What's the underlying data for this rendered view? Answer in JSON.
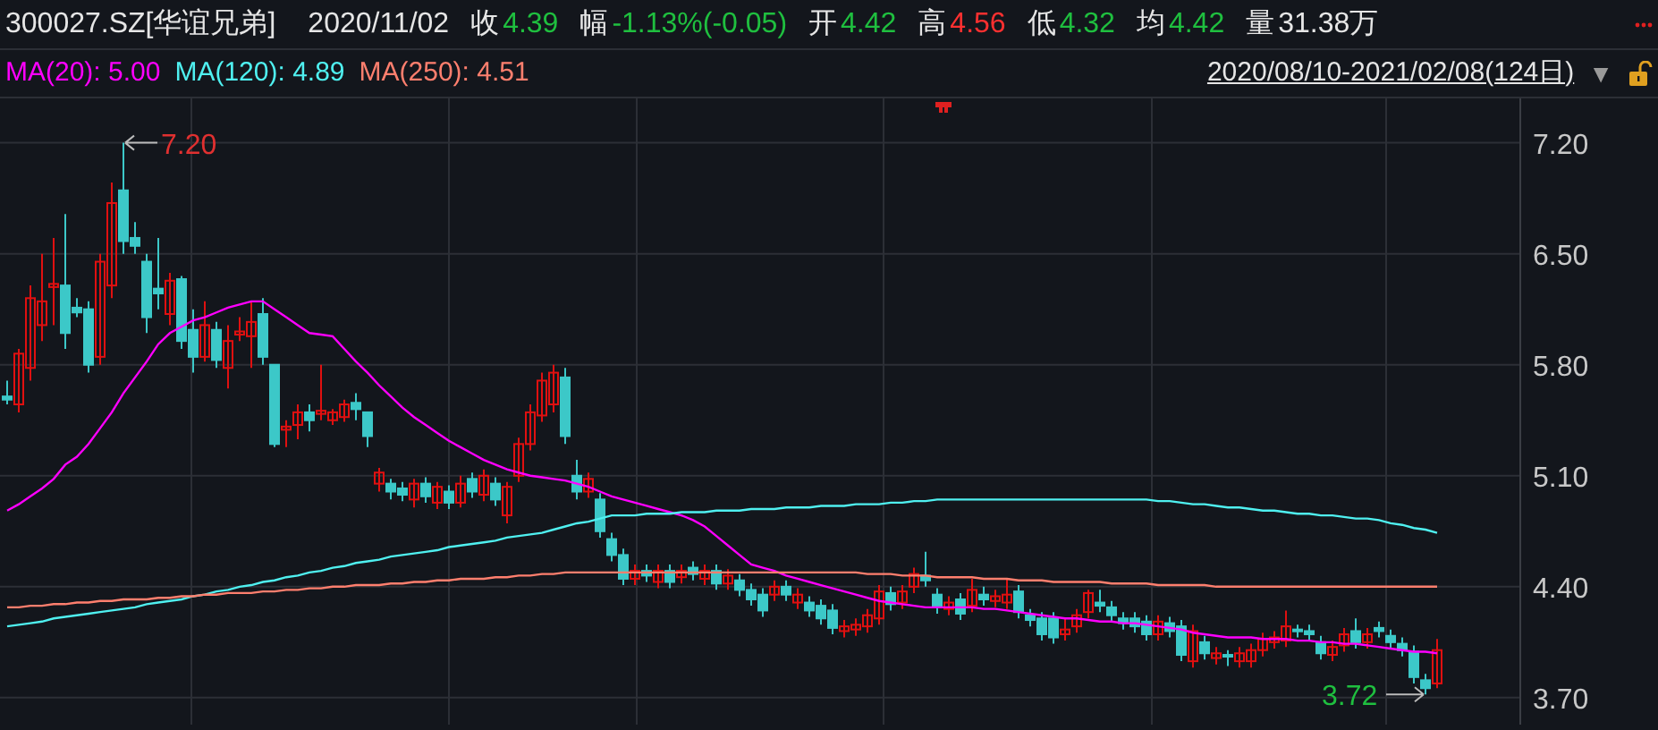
{
  "header": {
    "symbol": "300027.SZ[华谊兄弟]",
    "date": "2020/11/02",
    "quotes": [
      {
        "label": "收",
        "value": "4.39",
        "color": "#1fbf3f"
      },
      {
        "label": "幅",
        "value": "-1.13%(-0.05)",
        "color": "#1fbf3f"
      },
      {
        "label": "开",
        "value": "4.42",
        "color": "#1fbf3f"
      },
      {
        "label": "高",
        "value": "4.56",
        "color": "#ff3030"
      },
      {
        "label": "低",
        "value": "4.32",
        "color": "#1fbf3f"
      },
      {
        "label": "均",
        "value": "4.42",
        "color": "#1fbf3f"
      },
      {
        "label": "量",
        "value": "31.38万",
        "color": "#e6e6e6"
      }
    ]
  },
  "range": {
    "label": "2020/08/10-2021/02/08(124日)",
    "dropdown": "▼",
    "locked": false
  },
  "chart_data": {
    "type": "candlestick",
    "grid": true,
    "ohlc": [
      [
        5.6,
        5.7,
        5.55,
        5.58
      ],
      [
        5.55,
        5.9,
        5.5,
        5.87
      ],
      [
        5.78,
        6.3,
        5.7,
        6.22
      ],
      [
        6.05,
        6.5,
        5.95,
        6.2
      ],
      [
        6.29,
        6.6,
        6.05,
        6.31
      ],
      [
        6.3,
        6.75,
        5.9,
        6.0
      ],
      [
        6.16,
        6.22,
        6.1,
        6.13
      ],
      [
        6.15,
        6.2,
        5.75,
        5.8
      ],
      [
        5.85,
        6.5,
        5.8,
        6.45
      ],
      [
        6.3,
        6.95,
        6.22,
        6.82
      ],
      [
        6.9,
        7.2,
        6.5,
        6.58
      ],
      [
        6.6,
        6.7,
        6.5,
        6.55
      ],
      [
        6.45,
        6.5,
        6.0,
        6.1
      ],
      [
        6.28,
        6.6,
        6.15,
        6.25
      ],
      [
        6.12,
        6.38,
        6.05,
        6.33
      ],
      [
        6.34,
        6.36,
        5.9,
        5.95
      ],
      [
        6.02,
        6.15,
        5.75,
        5.85
      ],
      [
        5.85,
        6.2,
        5.82,
        6.05
      ],
      [
        6.02,
        6.07,
        5.78,
        5.83
      ],
      [
        5.78,
        6.05,
        5.65,
        5.95
      ],
      [
        5.99,
        6.1,
        5.95,
        6.01
      ],
      [
        5.98,
        6.2,
        5.78,
        6.07
      ],
      [
        6.12,
        6.22,
        5.8,
        5.85
      ],
      [
        5.8,
        5.8,
        5.28,
        5.3
      ],
      [
        5.39,
        5.45,
        5.28,
        5.41
      ],
      [
        5.42,
        5.55,
        5.33,
        5.5
      ],
      [
        5.5,
        5.55,
        5.38,
        5.45
      ],
      [
        5.49,
        5.8,
        5.45,
        5.51
      ],
      [
        5.45,
        5.52,
        5.42,
        5.5
      ],
      [
        5.47,
        5.58,
        5.44,
        5.55
      ],
      [
        5.56,
        5.62,
        5.45,
        5.52
      ],
      [
        5.5,
        5.5,
        5.28,
        5.35
      ],
      [
        5.05,
        5.15,
        5.0,
        5.12
      ],
      [
        5.05,
        5.08,
        4.95,
        5.0
      ],
      [
        5.02,
        5.06,
        4.94,
        4.98
      ],
      [
        4.95,
        5.08,
        4.9,
        5.05
      ],
      [
        5.05,
        5.09,
        4.93,
        4.97
      ],
      [
        4.93,
        5.06,
        4.89,
        5.03
      ],
      [
        5.0,
        5.04,
        4.89,
        4.93
      ],
      [
        4.93,
        5.1,
        4.9,
        5.05
      ],
      [
        5.08,
        5.12,
        4.96,
        5.0
      ],
      [
        4.98,
        5.14,
        4.94,
        5.1
      ],
      [
        5.05,
        5.09,
        4.91,
        4.95
      ],
      [
        4.85,
        5.06,
        4.8,
        5.03
      ],
      [
        5.1,
        5.34,
        5.06,
        5.3
      ],
      [
        5.3,
        5.55,
        5.26,
        5.5
      ],
      [
        5.48,
        5.75,
        5.44,
        5.7
      ],
      [
        5.55,
        5.8,
        5.5,
        5.75
      ],
      [
        5.72,
        5.78,
        5.3,
        5.35
      ],
      [
        5.1,
        5.2,
        4.95,
        5.0
      ],
      [
        5.0,
        5.12,
        4.96,
        5.08
      ],
      [
        4.95,
        4.99,
        4.71,
        4.75
      ],
      [
        4.7,
        4.74,
        4.56,
        4.6
      ],
      [
        4.6,
        4.64,
        4.41,
        4.45
      ],
      [
        4.45,
        4.54,
        4.41,
        4.5
      ],
      [
        4.5,
        4.54,
        4.43,
        4.47
      ],
      [
        4.43,
        4.54,
        4.39,
        4.5
      ],
      [
        4.5,
        4.54,
        4.39,
        4.43
      ],
      [
        4.46,
        4.54,
        4.42,
        4.5
      ],
      [
        4.52,
        4.56,
        4.44,
        4.48
      ],
      [
        4.45,
        4.54,
        4.41,
        4.5
      ],
      [
        4.5,
        4.54,
        4.38,
        4.42
      ],
      [
        4.42,
        4.51,
        4.38,
        4.47
      ],
      [
        4.44,
        4.48,
        4.34,
        4.38
      ],
      [
        4.38,
        4.42,
        4.28,
        4.32
      ],
      [
        4.35,
        4.39,
        4.21,
        4.25
      ],
      [
        4.35,
        4.44,
        4.31,
        4.4
      ],
      [
        4.4,
        4.44,
        4.31,
        4.35
      ],
      [
        4.3,
        4.39,
        4.26,
        4.35
      ],
      [
        4.3,
        4.34,
        4.21,
        4.25
      ],
      [
        4.28,
        4.32,
        4.16,
        4.2
      ],
      [
        4.25,
        4.29,
        4.1,
        4.14
      ],
      [
        4.12,
        4.19,
        4.08,
        4.15
      ],
      [
        4.13,
        4.2,
        4.09,
        4.16
      ],
      [
        4.15,
        4.26,
        4.11,
        4.22
      ],
      [
        4.2,
        4.41,
        4.16,
        4.37
      ],
      [
        4.36,
        4.4,
        4.25,
        4.29
      ],
      [
        4.3,
        4.41,
        4.26,
        4.37
      ],
      [
        4.4,
        4.52,
        4.36,
        4.48
      ],
      [
        4.47,
        4.62,
        4.4,
        4.44
      ],
      [
        4.35,
        4.39,
        4.23,
        4.27
      ],
      [
        4.26,
        4.34,
        4.22,
        4.3
      ],
      [
        4.32,
        4.36,
        4.19,
        4.23
      ],
      [
        4.28,
        4.45,
        4.24,
        4.38
      ],
      [
        4.35,
        4.4,
        4.28,
        4.32
      ],
      [
        4.31,
        4.38,
        4.27,
        4.34
      ],
      [
        4.3,
        4.45,
        4.26,
        4.35
      ],
      [
        4.37,
        4.41,
        4.2,
        4.24
      ],
      [
        4.22,
        4.26,
        4.15,
        4.19
      ],
      [
        4.2,
        4.24,
        4.06,
        4.1
      ],
      [
        4.2,
        4.24,
        4.04,
        4.08
      ],
      [
        4.1,
        4.2,
        4.06,
        4.13
      ],
      [
        4.15,
        4.26,
        4.11,
        4.22
      ],
      [
        4.24,
        4.38,
        4.2,
        4.36
      ],
      [
        4.3,
        4.38,
        4.24,
        4.28
      ],
      [
        4.27,
        4.31,
        4.18,
        4.22
      ],
      [
        4.2,
        4.24,
        4.13,
        4.17
      ],
      [
        4.2,
        4.24,
        4.11,
        4.15
      ],
      [
        4.18,
        4.22,
        4.06,
        4.1
      ],
      [
        4.1,
        4.22,
        4.06,
        4.18
      ],
      [
        4.17,
        4.21,
        4.08,
        4.12
      ],
      [
        4.15,
        4.19,
        3.93,
        3.97
      ],
      [
        3.93,
        4.16,
        3.89,
        4.12
      ],
      [
        4.05,
        4.09,
        3.94,
        3.98
      ],
      [
        3.95,
        4.02,
        3.91,
        3.98
      ],
      [
        3.97,
        4.0,
        3.9,
        3.96
      ],
      [
        3.93,
        4.02,
        3.89,
        3.98
      ],
      [
        3.93,
        4.04,
        3.89,
        4.0
      ],
      [
        4.0,
        4.11,
        3.96,
        4.07
      ],
      [
        4.05,
        4.12,
        4.01,
        4.08
      ],
      [
        4.06,
        4.25,
        4.02,
        4.15
      ],
      [
        4.13,
        4.16,
        4.08,
        4.12
      ],
      [
        4.12,
        4.16,
        4.06,
        4.1
      ],
      [
        4.05,
        4.09,
        3.94,
        3.98
      ],
      [
        3.97,
        4.06,
        3.93,
        4.02
      ],
      [
        4.03,
        4.14,
        3.99,
        4.1
      ],
      [
        4.12,
        4.2,
        4.01,
        4.05
      ],
      [
        4.05,
        4.14,
        4.01,
        4.1
      ],
      [
        4.14,
        4.18,
        4.08,
        4.12
      ],
      [
        4.09,
        4.13,
        4.01,
        4.05
      ],
      [
        4.04,
        4.08,
        3.96,
        4.0
      ],
      [
        3.99,
        4.03,
        3.79,
        3.83
      ],
      [
        3.81,
        3.85,
        3.72,
        3.76
      ],
      [
        3.79,
        4.07,
        3.76,
        4.0
      ]
    ],
    "yticks": [
      {
        "value": 3.7,
        "label": "3.70"
      },
      {
        "value": 4.4,
        "label": "4.40"
      },
      {
        "value": 5.1,
        "label": "5.10"
      },
      {
        "value": 5.8,
        "label": "5.80"
      },
      {
        "value": 6.5,
        "label": "6.50"
      },
      {
        "value": 7.2,
        "label": "7.20"
      }
    ],
    "ylim": [
      3.53,
      7.48
    ],
    "series": [
      {
        "name": "MA(20): 5.00",
        "type": "line",
        "color": "#ff00ff",
        "values": [
          4.88,
          4.92,
          4.97,
          5.02,
          5.08,
          5.17,
          5.22,
          5.3,
          5.4,
          5.5,
          5.62,
          5.72,
          5.82,
          5.93,
          6.0,
          6.04,
          6.08,
          6.1,
          6.13,
          6.16,
          6.18,
          6.2,
          6.2,
          6.15,
          6.1,
          6.05,
          6.0,
          5.99,
          5.98,
          5.9,
          5.82,
          5.75,
          5.67,
          5.6,
          5.53,
          5.47,
          5.42,
          5.37,
          5.32,
          5.28,
          5.24,
          5.2,
          5.17,
          5.14,
          5.12,
          5.1,
          5.09,
          5.08,
          5.07,
          5.05,
          5.03,
          5.0,
          4.97,
          4.95,
          4.93,
          4.91,
          4.89,
          4.87,
          4.85,
          4.82,
          4.78,
          4.72,
          4.66,
          4.6,
          4.54,
          4.52,
          4.5,
          4.47,
          4.45,
          4.43,
          4.41,
          4.39,
          4.37,
          4.35,
          4.33,
          4.31,
          4.3,
          4.29,
          4.28,
          4.27,
          4.27,
          4.27,
          4.27,
          4.27,
          4.26,
          4.26,
          4.25,
          4.24,
          4.23,
          4.22,
          4.21,
          4.2,
          4.2,
          4.19,
          4.18,
          4.18,
          4.17,
          4.17,
          4.16,
          4.15,
          4.14,
          4.13,
          4.11,
          4.1,
          4.09,
          4.08,
          4.08,
          4.08,
          4.07,
          4.07,
          4.07,
          4.06,
          4.06,
          4.05,
          4.05,
          4.04,
          4.04,
          4.03,
          4.02,
          4.01,
          4.0,
          3.99,
          3.99,
          3.98
        ]
      },
      {
        "name": "MA(120): 4.89",
        "type": "line",
        "color": "#4ff0f0",
        "values": [
          4.15,
          4.16,
          4.17,
          4.18,
          4.2,
          4.21,
          4.22,
          4.23,
          4.24,
          4.25,
          4.26,
          4.27,
          4.29,
          4.3,
          4.31,
          4.32,
          4.34,
          4.35,
          4.37,
          4.38,
          4.4,
          4.41,
          4.43,
          4.44,
          4.46,
          4.47,
          4.49,
          4.5,
          4.52,
          4.53,
          4.55,
          4.56,
          4.57,
          4.59,
          4.6,
          4.61,
          4.62,
          4.63,
          4.65,
          4.66,
          4.67,
          4.68,
          4.69,
          4.71,
          4.72,
          4.73,
          4.74,
          4.76,
          4.78,
          4.8,
          4.81,
          4.83,
          4.85,
          4.85,
          4.85,
          4.86,
          4.86,
          4.86,
          4.87,
          4.87,
          4.87,
          4.88,
          4.88,
          4.88,
          4.89,
          4.89,
          4.89,
          4.9,
          4.9,
          4.9,
          4.91,
          4.91,
          4.91,
          4.92,
          4.92,
          4.92,
          4.93,
          4.93,
          4.94,
          4.94,
          4.95,
          4.95,
          4.95,
          4.95,
          4.95,
          4.95,
          4.95,
          4.95,
          4.95,
          4.95,
          4.95,
          4.95,
          4.95,
          4.95,
          4.95,
          4.95,
          4.95,
          4.95,
          4.95,
          4.94,
          4.94,
          4.93,
          4.92,
          4.92,
          4.91,
          4.9,
          4.9,
          4.89,
          4.88,
          4.88,
          4.87,
          4.86,
          4.86,
          4.85,
          4.85,
          4.84,
          4.83,
          4.83,
          4.82,
          4.8,
          4.79,
          4.77,
          4.76,
          4.74
        ]
      },
      {
        "name": "MA(250): 4.51",
        "type": "line",
        "color": "#ff7f6e",
        "values": [
          4.27,
          4.27,
          4.28,
          4.28,
          4.29,
          4.29,
          4.3,
          4.3,
          4.31,
          4.31,
          4.32,
          4.32,
          4.32,
          4.33,
          4.33,
          4.34,
          4.34,
          4.35,
          4.35,
          4.36,
          4.36,
          4.36,
          4.37,
          4.37,
          4.38,
          4.38,
          4.39,
          4.39,
          4.4,
          4.4,
          4.41,
          4.41,
          4.41,
          4.42,
          4.42,
          4.43,
          4.43,
          4.44,
          4.44,
          4.45,
          4.45,
          4.45,
          4.46,
          4.46,
          4.47,
          4.47,
          4.48,
          4.48,
          4.49,
          4.49,
          4.49,
          4.49,
          4.49,
          4.49,
          4.49,
          4.49,
          4.49,
          4.49,
          4.49,
          4.49,
          4.49,
          4.49,
          4.49,
          4.49,
          4.49,
          4.49,
          4.49,
          4.49,
          4.49,
          4.49,
          4.49,
          4.49,
          4.49,
          4.49,
          4.48,
          4.48,
          4.48,
          4.47,
          4.47,
          4.47,
          4.46,
          4.46,
          4.46,
          4.46,
          4.45,
          4.45,
          4.45,
          4.44,
          4.44,
          4.44,
          4.43,
          4.43,
          4.43,
          4.43,
          4.43,
          4.42,
          4.42,
          4.42,
          4.42,
          4.41,
          4.41,
          4.41,
          4.41,
          4.41,
          4.4,
          4.4,
          4.4,
          4.4,
          4.4,
          4.4,
          4.4,
          4.4,
          4.4,
          4.4,
          4.4,
          4.4,
          4.4,
          4.4,
          4.4,
          4.4,
          4.4,
          4.4,
          4.4,
          4.4
        ]
      }
    ],
    "annotations": [
      "7.20",
      "3.72"
    ]
  }
}
